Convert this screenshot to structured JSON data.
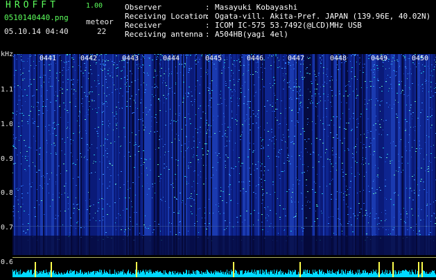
{
  "header": {
    "app_title": "HROFFT",
    "version": "1.00",
    "filename": "0510140440.png",
    "datetime": "05.10.14 04:40",
    "meteor_label": "meteor",
    "meteor_count": "22"
  },
  "info": [
    {
      "label": "Observer",
      "sep": ":",
      "value": "Masayuki Kobayashi"
    },
    {
      "label": "Receiving Location",
      "sep": ":",
      "value": "Ogata-vill. Akita-Pref. JAPAN (139.96E, 40.02N)"
    },
    {
      "label": "Receiver",
      "sep": ":",
      "value": "ICOM IC-575 53.7492(@LCD)MHz USB"
    },
    {
      "label": "Receiving antenna",
      "sep": ":",
      "value": "A504HB(yagi 4el)"
    }
  ],
  "axis": {
    "unit": "kHz",
    "y_ticks": [
      "1.1",
      "1.0",
      "0.9",
      "0.8",
      "0.7",
      "0.6"
    ],
    "time_ticks": [
      "0441",
      "0442",
      "0443",
      "0444",
      "0445",
      "0446",
      "0447",
      "0448",
      "0449",
      "0450"
    ]
  },
  "colors": {
    "background": "#000000",
    "spectrogram_base": "#071060",
    "header_green": "#5cff5c",
    "header_white": "#ffffff",
    "tick_yellow": "#ffff4c",
    "signal_cyan": "#00e0ff"
  }
}
